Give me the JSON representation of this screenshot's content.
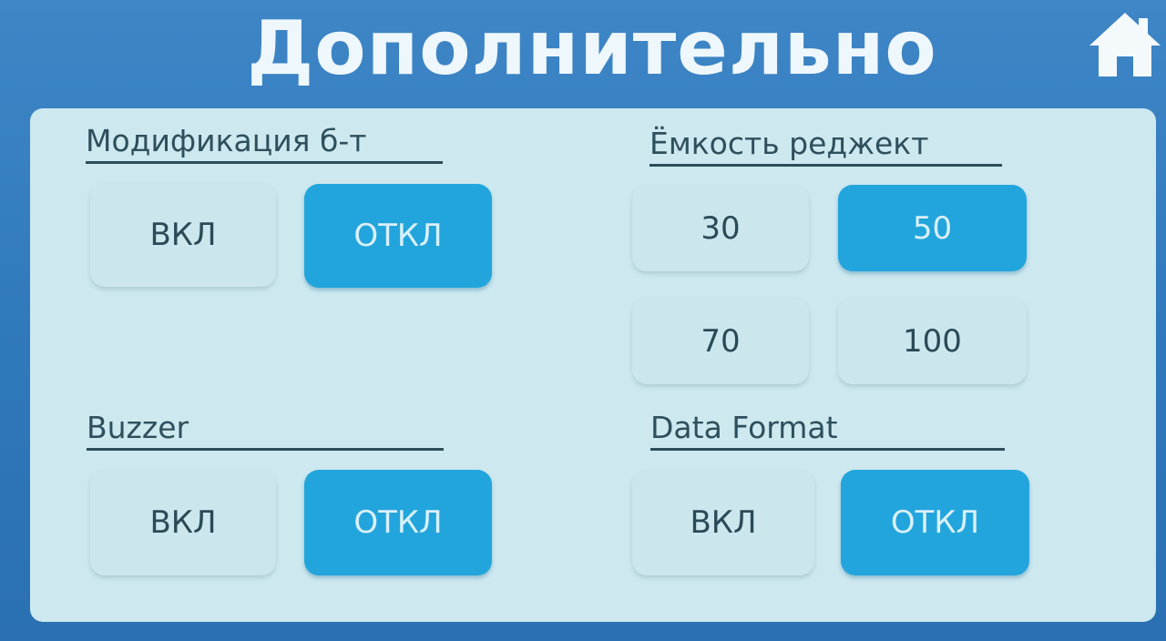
{
  "header": {
    "title": "Дополнительно",
    "home_icon": "home-icon"
  },
  "colors": {
    "header_bg": "#3e86c6",
    "panel_bg": "#cde8ef",
    "active": "#22a5dc",
    "text_dark": "#2e4f5c"
  },
  "sections": {
    "mod": {
      "label": "Модификация б-т",
      "on_label": "ВКЛ",
      "off_label": "ОТКЛ",
      "selected": "ОТКЛ"
    },
    "capacity": {
      "label": "Ёмкость реджект",
      "options": [
        "30",
        "50",
        "70",
        "100"
      ],
      "selected": "50"
    },
    "buzzer": {
      "label": "Buzzer",
      "on_label": "ВКЛ",
      "off_label": "ОТКЛ",
      "selected": "ОТКЛ"
    },
    "data_format": {
      "label": "Data Format",
      "on_label": "ВКЛ",
      "off_label": "ОТКЛ",
      "selected": "ОТКЛ"
    }
  }
}
